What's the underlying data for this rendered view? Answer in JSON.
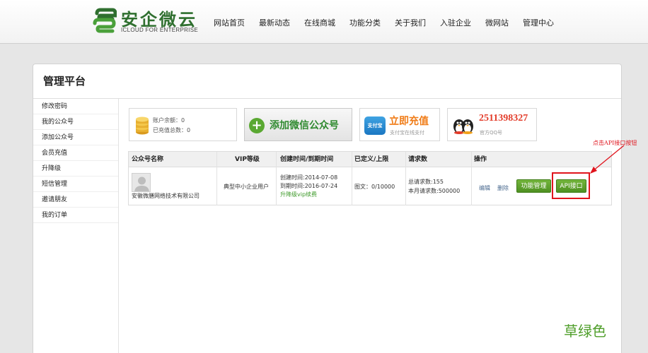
{
  "header": {
    "logo_title": "安企微云",
    "logo_subtitle": "ICLOUD FOR ENTERPRISE",
    "nav": [
      "网站首页",
      "最新动态",
      "在线商城",
      "功能分类",
      "关于我们",
      "入驻企业",
      "微网站",
      "管理中心"
    ]
  },
  "panel": {
    "title": "管理平台"
  },
  "sidebar": {
    "items": [
      "修改密码",
      "我的公众号",
      "添加公众号",
      "会员充值",
      "升降级",
      "短信管理",
      "邀请朋友",
      "我的订单"
    ]
  },
  "account": {
    "balance_label": "账户余额：",
    "balance_value": "0",
    "recharged_label": "已充值总数：",
    "recharged_value": "0"
  },
  "actions": {
    "add_wechat": "添加微信公众号",
    "recharge_title": "立即充值",
    "recharge_sub": "支付宝在线支付",
    "alipay_icon_text": "支付宝",
    "qq_number": "2511398327",
    "qq_sub": "官方QQ号"
  },
  "table": {
    "headers": [
      "公众号名称",
      "VIP等级",
      "创建时间/到期时间",
      "已定义/上限",
      "请求数",
      "操作"
    ],
    "row": {
      "name": "安徽微膳网络技术有限公司",
      "vip": "典型中小企业用户",
      "created": "创建时间:2014-07-08",
      "expires": "到期时间:2016-07-24",
      "upgrade": "升降级vip续费",
      "defined": "图文：0/10000",
      "total_requests": "总请求数:155",
      "month_requests": "本月请求数:500000",
      "edit": "编辑",
      "delete": "删除",
      "func_btn": "功能管理",
      "api_btn": "API接口"
    }
  },
  "annotation": {
    "text": "点击API接口按钮",
    "color": "#e0141d"
  },
  "watermark": "草绿色",
  "colors": {
    "brand_green": "#2f6f2f",
    "button_green": "#5a9e2b",
    "recharge_orange": "#f07c17",
    "qq_red": "#e33c2a"
  }
}
